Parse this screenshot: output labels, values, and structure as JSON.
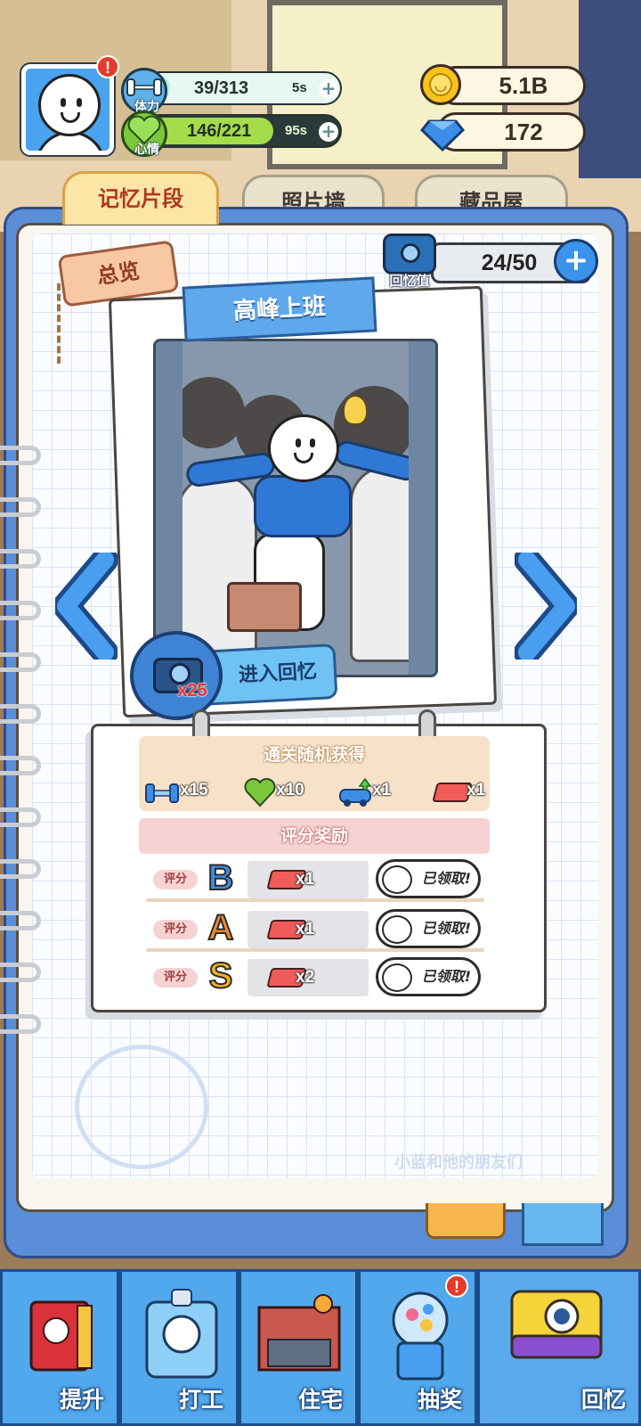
{
  "header": {
    "stamina": {
      "label": "体力",
      "value": "39/313",
      "timer": "5s",
      "fill": 0.125
    },
    "mood": {
      "label": "心情",
      "value": "146/221",
      "timer": "95s",
      "fill": 0.66
    },
    "coins": "5.1B",
    "gems": "172"
  },
  "tabs": [
    {
      "label": "记忆片段",
      "active": true
    },
    {
      "label": "照片墙",
      "active": false
    },
    {
      "label": "藏品屋",
      "active": false
    }
  ],
  "overview_tag": "总览",
  "memory_value": {
    "label": "回忆值",
    "value": "24/50"
  },
  "memory_card": {
    "title": "高峰上班",
    "enter_label": "进入回忆",
    "enter_cost": "x25"
  },
  "clear_rewards": {
    "title": "通关随机获得",
    "items": [
      {
        "icon": "dumbbell-icon",
        "qty": "x15"
      },
      {
        "icon": "heart-icon",
        "qty": "x10"
      },
      {
        "icon": "car-upgrade-icon",
        "qty": "x1"
      },
      {
        "icon": "brick-icon",
        "qty": "x1"
      }
    ]
  },
  "score_rewards": {
    "title": "评分奖励",
    "rows": [
      {
        "tag": "评分",
        "grade": "B",
        "grade_color": "#3d8de6",
        "qty": "x1",
        "status": "已领取!"
      },
      {
        "tag": "评分",
        "grade": "A",
        "grade_color": "#f08a2c",
        "qty": "x1",
        "status": "已领取!"
      },
      {
        "tag": "评分",
        "grade": "S",
        "grade_color": "#f2b321",
        "qty": "x2",
        "status": "已领取!"
      }
    ]
  },
  "decoration_text": "小蓝和他的朋友们",
  "bottom_nav": [
    {
      "label": "提升",
      "icon": "book-icon",
      "active": false
    },
    {
      "label": "打工",
      "icon": "id-badge-icon",
      "active": false
    },
    {
      "label": "住宅",
      "icon": "house-icon",
      "active": false
    },
    {
      "label": "抽奖",
      "icon": "gacha-machine-icon",
      "active": false,
      "alert": "!"
    },
    {
      "label": "回忆",
      "icon": "camera-icon",
      "active": true
    }
  ],
  "alerts": {
    "avatar": "!"
  },
  "colors": {
    "accent_blue": "#3b93ec",
    "tab_active_text": "#b3361f",
    "stamina_fill": "#b7f0e0",
    "mood_fill": "#a4dc4a"
  }
}
